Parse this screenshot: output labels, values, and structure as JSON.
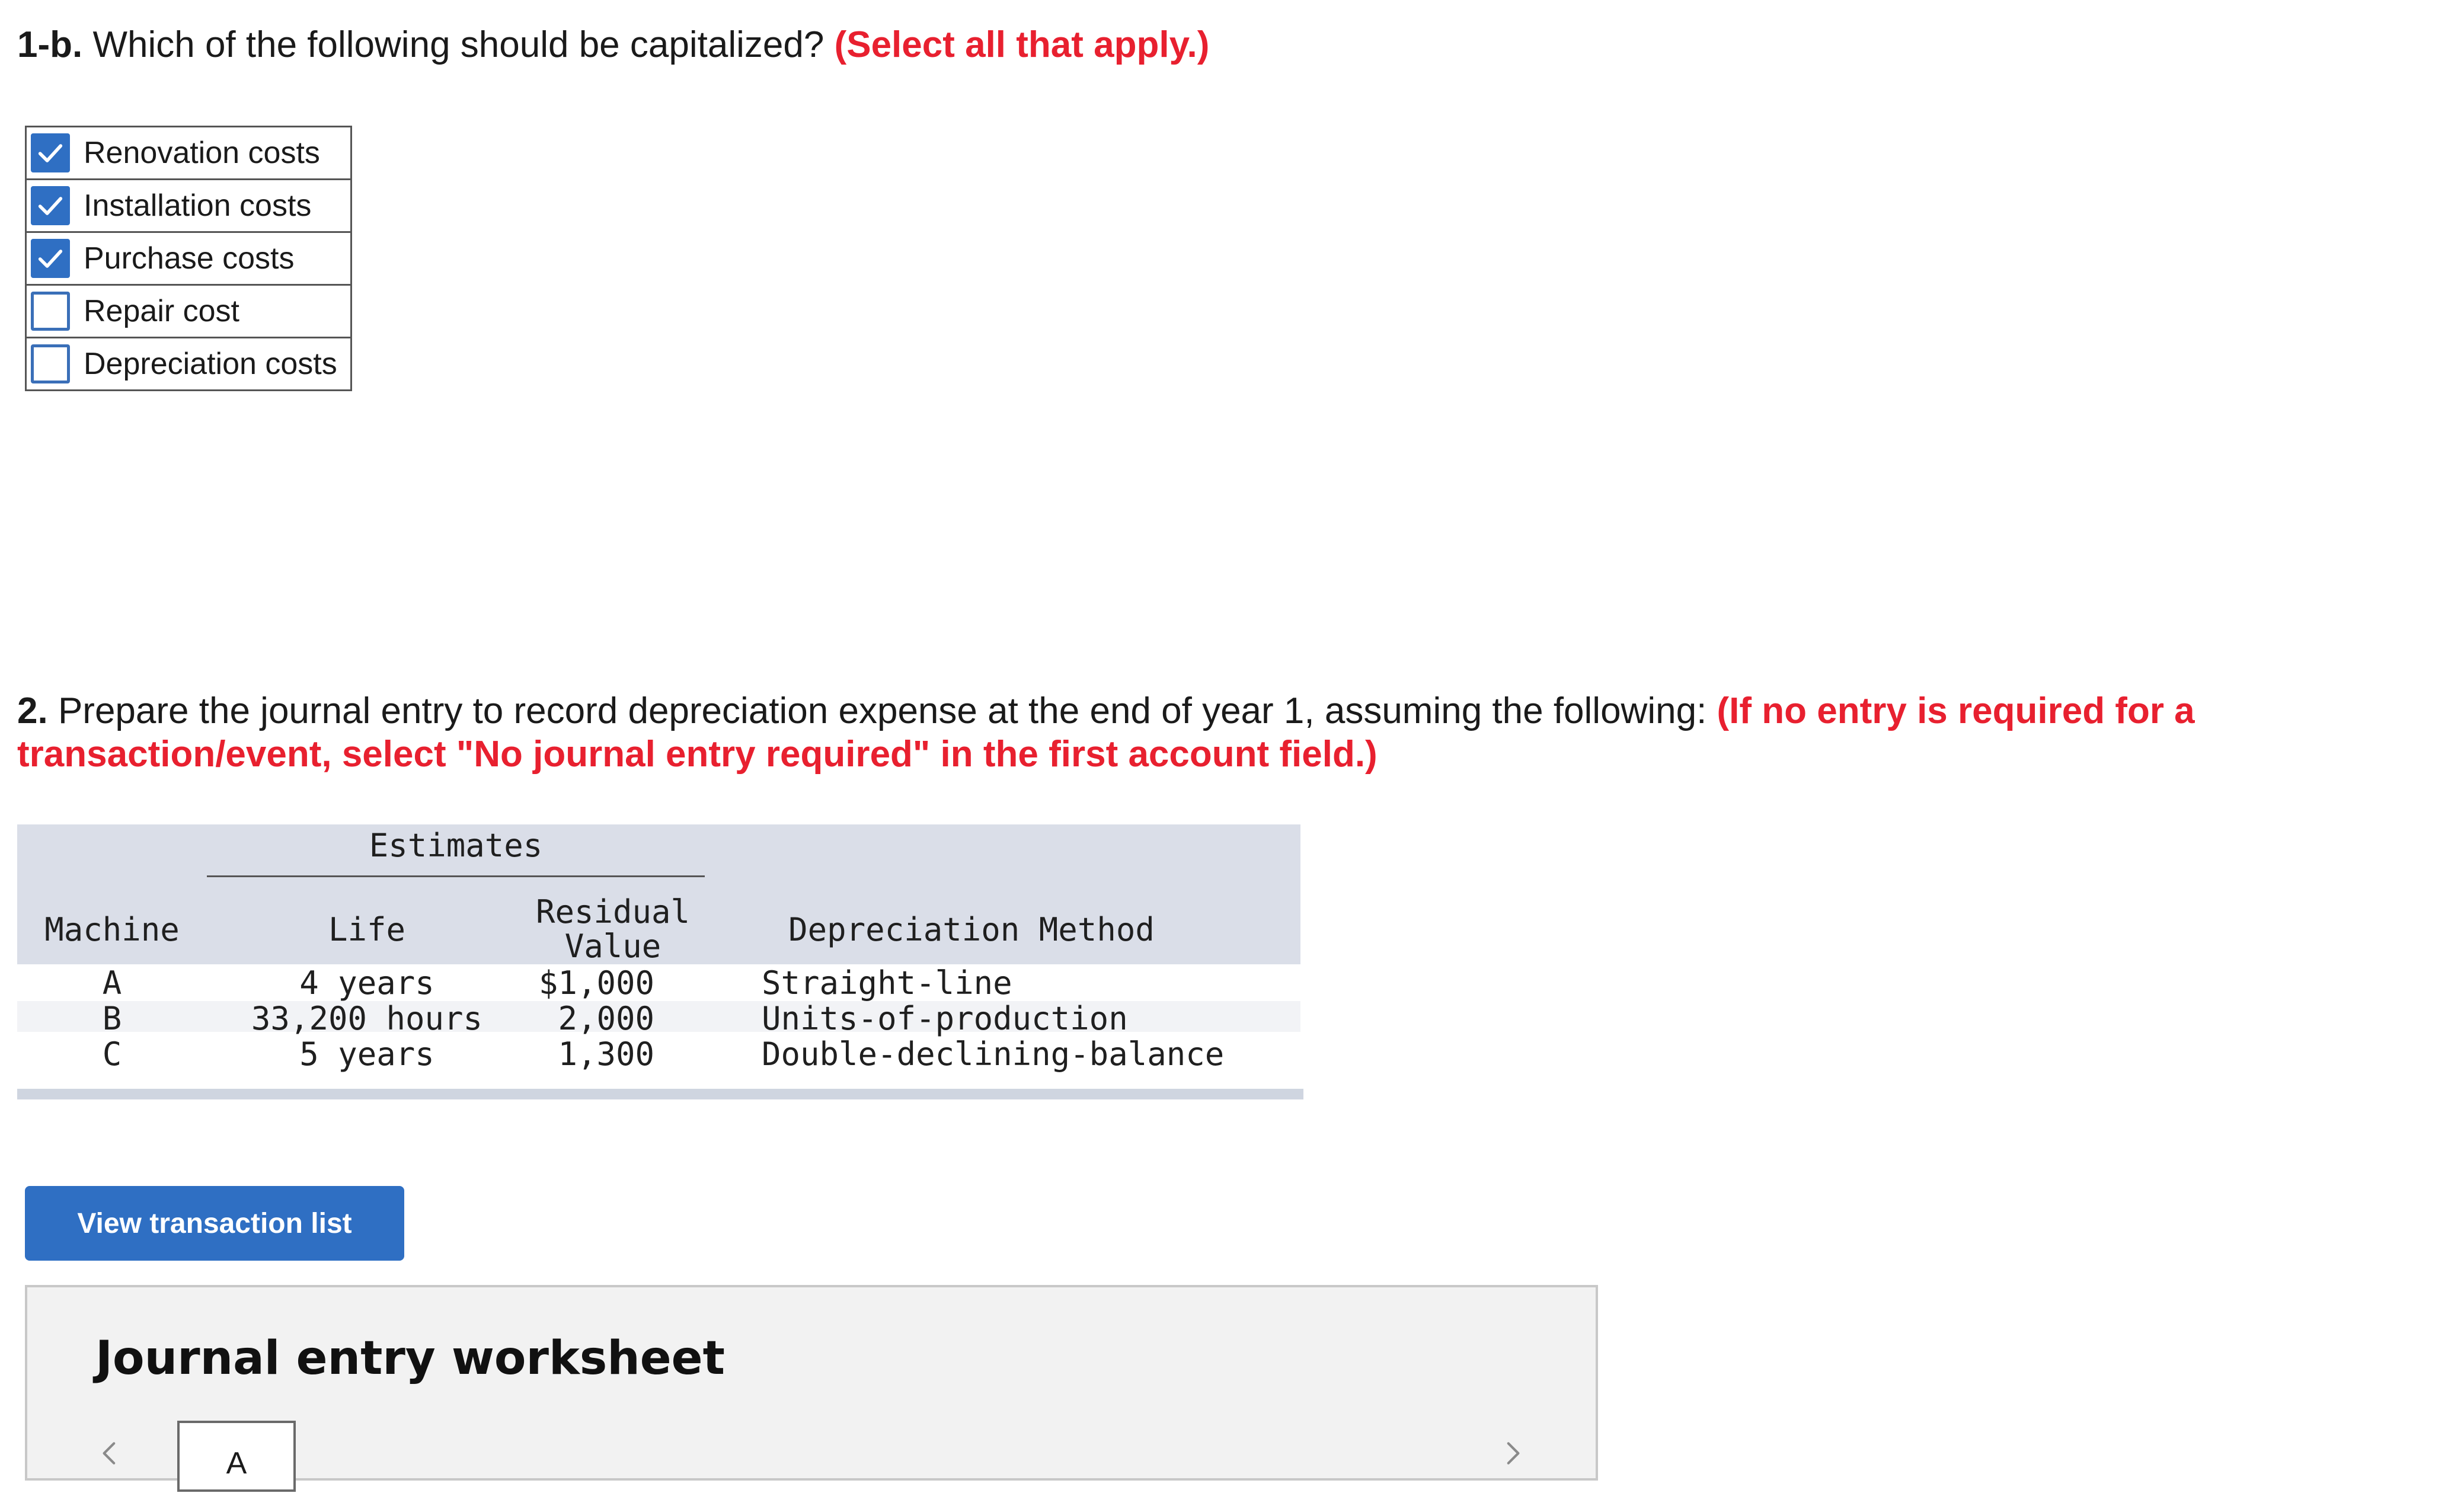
{
  "question_1b": {
    "number": "1-b.",
    "text": "Which of the following should be capitalized?",
    "instruction": "(Select all that apply.)",
    "options": [
      {
        "label": "Renovation costs",
        "checked": true
      },
      {
        "label": "Installation costs",
        "checked": true
      },
      {
        "label": "Purchase costs",
        "checked": true
      },
      {
        "label": "Repair cost",
        "checked": false
      },
      {
        "label": "Depreciation costs",
        "checked": false
      }
    ]
  },
  "question_2": {
    "number": "2.",
    "text": "Prepare the journal entry to record depreciation expense at the end of year 1, assuming the following:",
    "instruction": "(If no entry is required for a transaction/event, select \"No journal entry required\" in the first account field.)"
  },
  "estimates_table": {
    "group_header": "Estimates",
    "headers": {
      "machine": "Machine",
      "life": "Life",
      "residual_value_line1": "Residual",
      "residual_value_line2": "Value",
      "method": "Depreciation Method"
    },
    "rows": [
      {
        "machine": "A",
        "life": "4 years",
        "residual": "$1,000",
        "method": "Straight-line"
      },
      {
        "machine": "B",
        "life": "33,200 hours",
        "residual": "2,000",
        "method": "Units-of-production"
      },
      {
        "machine": "C",
        "life": "5 years",
        "residual": "1,300",
        "method": "Double-declining-balance"
      }
    ]
  },
  "view_button_label": "View transaction list",
  "worksheet": {
    "title": "Journal entry worksheet",
    "active_tab": "A"
  },
  "colors": {
    "accent_red": "#e8202f",
    "button_blue": "#2f6fc3",
    "table_header_bg": "#dadee8"
  }
}
